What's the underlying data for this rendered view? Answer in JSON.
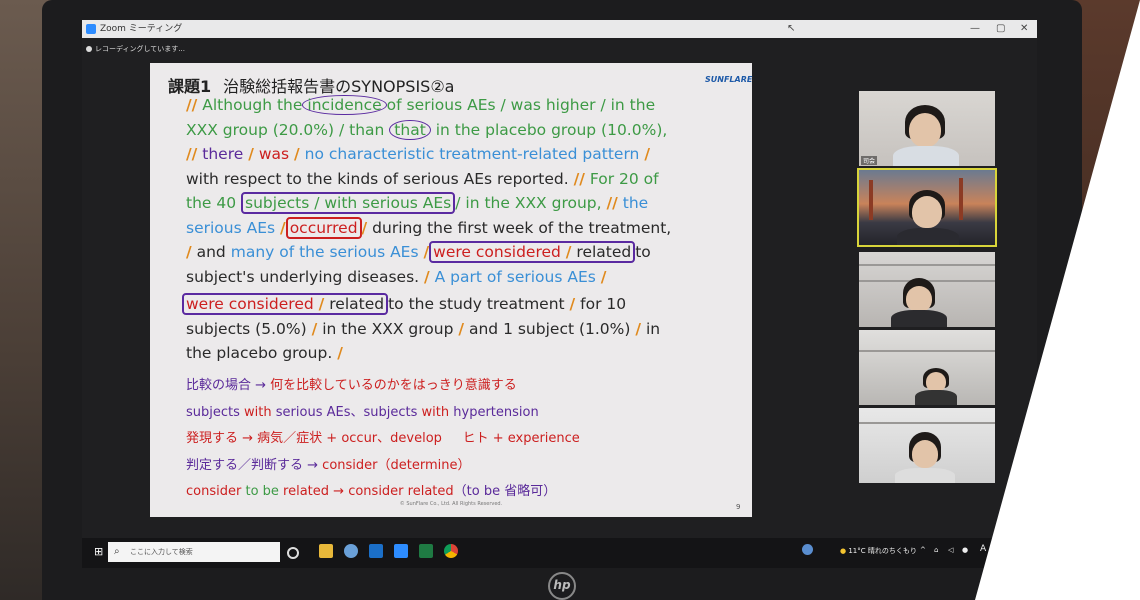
{
  "window": {
    "title": "Zoom ミーティング",
    "recording": "レコーディングしています..."
  },
  "slide": {
    "heading_label": "課題1",
    "heading_rest": "治験総括報告書のSYNOPSIS②a",
    "brand": "SUNFLARE",
    "footer": "© SunFlare Co., Ltd. All Rights Reserved.",
    "page_number": "9",
    "lines": {
      "l1_a": "//",
      "l1_b": "Although the",
      "l1_c": "incidence",
      "l1_d": "of serious AEs / was higher / in the",
      "l2_a": "XXX group (20.0%) / than",
      "l2_b": "that",
      "l2_c": "in the placebo group (10.0%),",
      "l3_a": "//",
      "l3_b": "there",
      "l3_c": "/",
      "l3_d": "was",
      "l3_e": "/",
      "l3_f": "no characteristic treatment-related pattern",
      "l3_g": "/",
      "l4_a": "with respect to the kinds of serious AEs reported.",
      "l4_b": "//",
      "l4_c": "For 20 of",
      "l5_a": "the 40",
      "l5_b": "subjects / with serious AEs",
      "l5_c": "/ in the XXX group,",
      "l5_d": "//",
      "l5_e": "the",
      "l6_a": "serious AEs",
      "l6_b": "/",
      "l6_c": "occurred",
      "l6_d": "/",
      "l6_e": "during the first week of the treatment,",
      "l7_a": "/",
      "l7_b": "and",
      "l7_c": "many of the serious AEs",
      "l7_d": "/",
      "l7_e": "were considered",
      "l7_f": "/",
      "l7_g": "related",
      "l7_h": "to",
      "l8_a": "subject's underlying diseases.",
      "l8_b": "/",
      "l8_c": "A part of serious AEs",
      "l8_d": "/",
      "l9_a": "were considered",
      "l9_b": "/",
      "l9_c": "related",
      "l9_d": "to the study treatment",
      "l9_e": "/",
      "l9_f": "for 10",
      "l10_a": "subjects (5.0%)",
      "l10_b": "/",
      "l10_c": "in the XXX group",
      "l10_d": "/",
      "l10_e": "and 1 subject (1.0%)",
      "l10_f": "/",
      "l10_g": "in",
      "l11_a": "the placebo group.",
      "l11_b": "/"
    },
    "notes": {
      "n1_a": "比較の場合 →",
      "n1_b": "何を比較しているのかをはっきり意識する",
      "n2_a": "subjects",
      "n2_b": "with",
      "n2_c": "serious AEs、subjects",
      "n2_d": "with",
      "n2_e": "hypertension",
      "n3_a": "発現する → 病気／症状 + occur、develop",
      "n3_b": "ヒト + experience",
      "n4_a": "判定する／判断する →",
      "n4_b": "consider（determine）",
      "n5_a": "consider",
      "n5_b": "to be",
      "n5_c": "related →",
      "n5_d": "consider related",
      "n5_e": "（to be 省略可）"
    }
  },
  "participants": [
    {
      "name": "司会",
      "active": false
    },
    {
      "name": "",
      "active": true
    },
    {
      "name": "",
      "active": false
    },
    {
      "name": "",
      "active": false
    },
    {
      "name": "",
      "active": false
    }
  ],
  "taskbar": {
    "search_placeholder": "ここに入力して検索",
    "weather": "11°C 晴れのちくもり",
    "ime": "A"
  },
  "colors": {
    "green": "#3d9a45",
    "blue": "#3a8fd6",
    "red": "#cc1f1f",
    "purple": "#5a2a9a",
    "orange": "#e08a1e"
  }
}
